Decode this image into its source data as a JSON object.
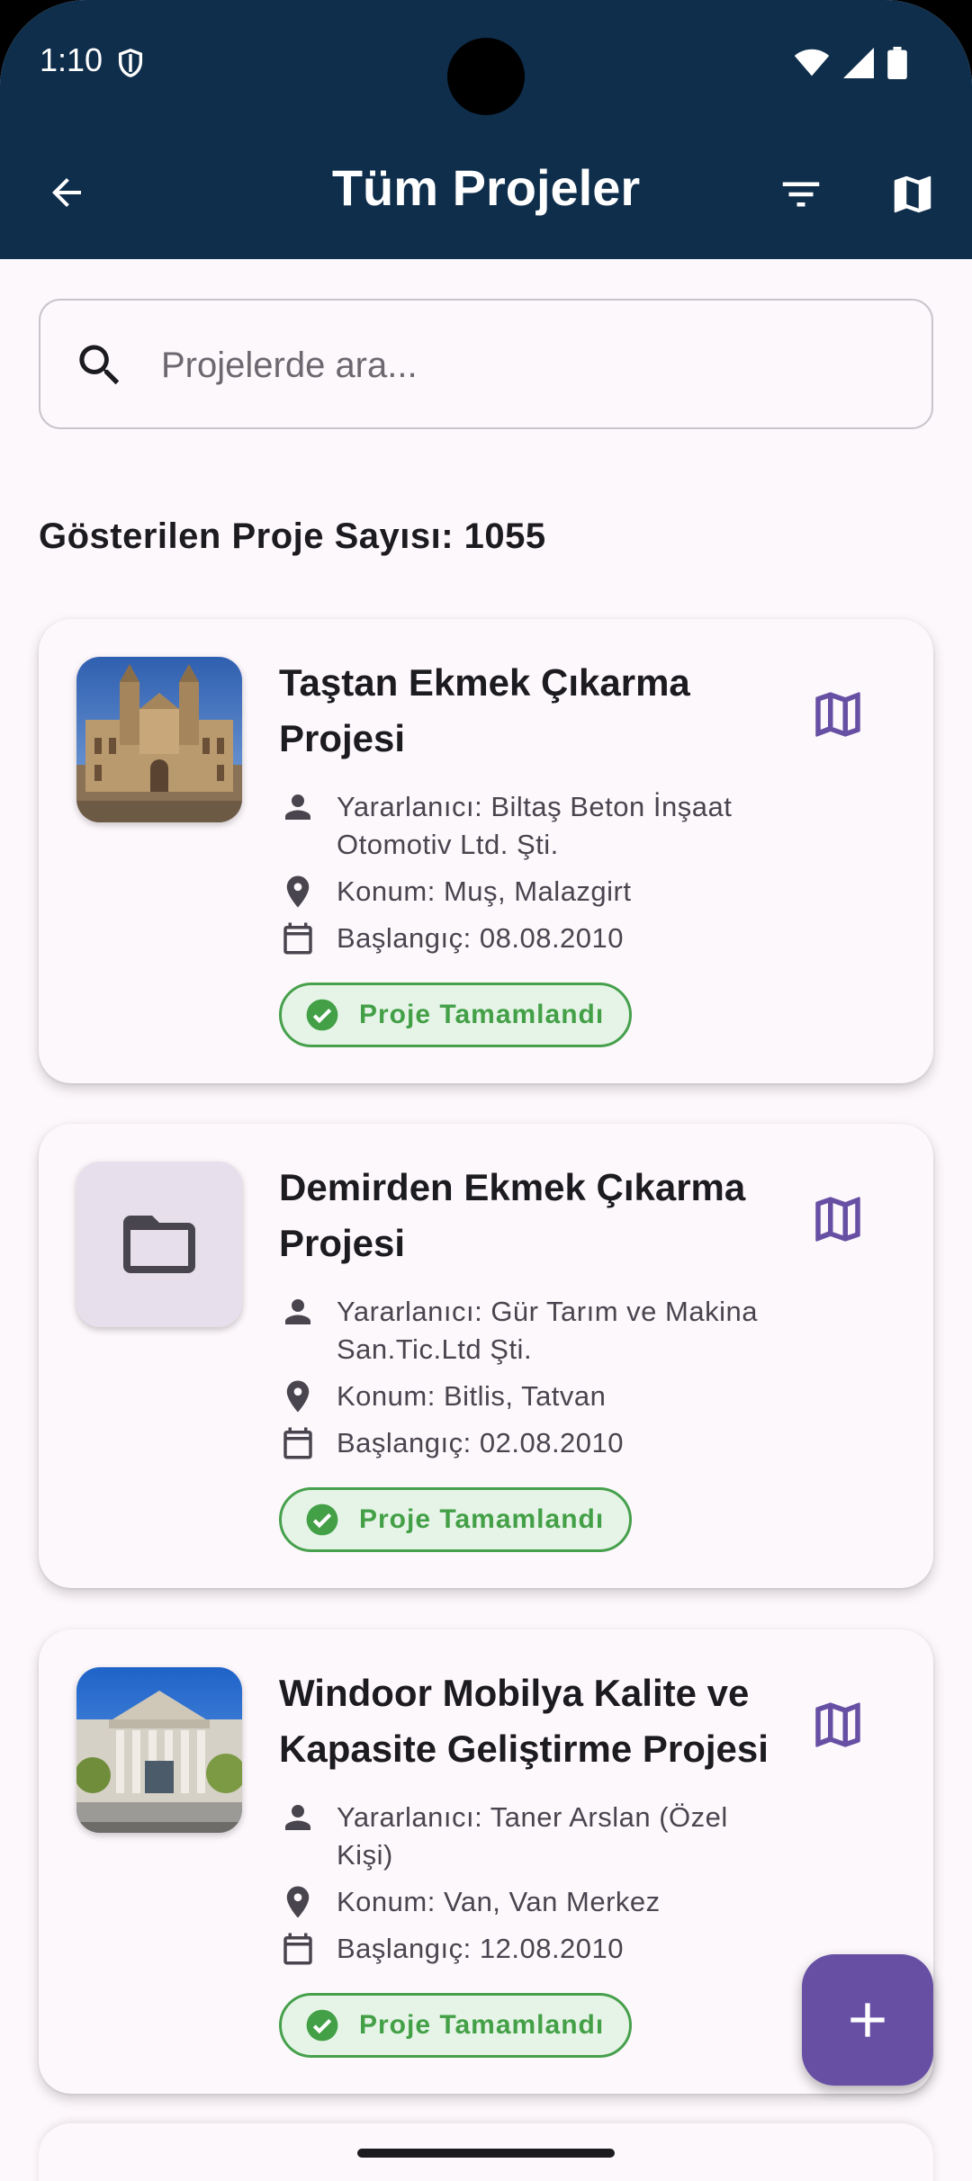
{
  "status_bar": {
    "time": "1:10"
  },
  "app_bar": {
    "title": "Tüm Projeler",
    "icons": [
      "arrow-back-icon",
      "filter-icon",
      "map-icon"
    ]
  },
  "search": {
    "placeholder": "Projelerde ara...",
    "value": ""
  },
  "project_count": {
    "label": "Gösterilen Proje Sayısı: 1055"
  },
  "projects": [
    {
      "title": "Taştan Ekmek Çıkarma Projesi",
      "beneficiary": "Yararlanıcı: Biltaş Beton İnşaat Otomotiv Ltd. Şti.",
      "location": "Konum: Muş, Malazgirt",
      "start": "Başlangıç: 08.08.2010",
      "status": "Proje Tamamlandı",
      "thumbnail": "museum-photo"
    },
    {
      "title": "Demirden Ekmek Çıkarma Projesi",
      "beneficiary": "Yararlanıcı: Gür Tarım ve Makina San.Tic.Ltd Şti.",
      "location": "Konum: Bitlis, Tatvan",
      "start": "Başlangıç: 02.08.2010",
      "status": "Proje Tamamlandı",
      "thumbnail": "folder-icon"
    },
    {
      "title": "Windoor Mobilya Kalite ve Kapasite Geliştirme Projesi",
      "beneficiary": "Yararlanıcı: Taner Arslan (Özel Kişi)",
      "location": "Konum: Van, Van Merkez",
      "start": "Başlangıç: 12.08.2010",
      "status": "Proje Tamamlandı",
      "thumbnail": "building-photo"
    }
  ],
  "colors": {
    "app_bar": "#0f2e4b",
    "accent": "#6750a4",
    "status_green": "#43a047",
    "background": "#fdf8fc"
  }
}
